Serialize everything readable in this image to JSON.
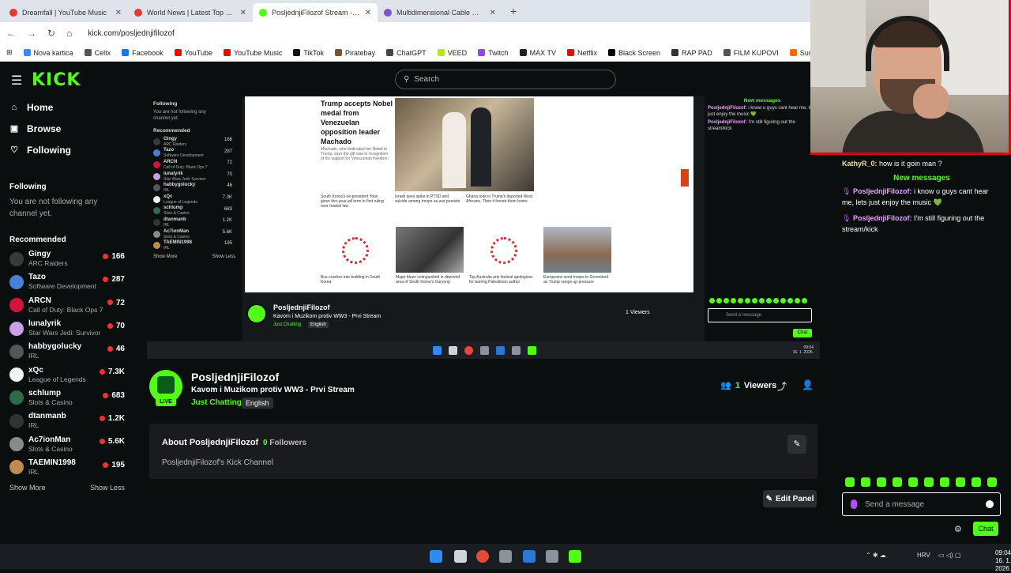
{
  "browser": {
    "tabs": [
      {
        "title": "Dreamfall | YouTube Music",
        "fav_color": "#e53935",
        "active": false
      },
      {
        "title": "World News | Latest Top Stories",
        "fav_color": "#e53935",
        "active": false
      },
      {
        "title": "PosljednjiFilozof Stream - Watch",
        "fav_color": "#53fc18",
        "active": true
      },
      {
        "title": "Multidimensional Cable Myth",
        "fav_color": "#7e57c2",
        "active": false
      }
    ],
    "url": "kick.com/posljednjifilozof",
    "bookmarks": [
      {
        "label": "Nova kartica",
        "color": "#4285f4"
      },
      {
        "label": "Celtx",
        "color": "#555555"
      },
      {
        "label": "Facebook",
        "color": "#1877f2"
      },
      {
        "label": "YouTube",
        "color": "#ff0000"
      },
      {
        "label": "YouTube Music",
        "color": "#ff0000"
      },
      {
        "label": "TikTok",
        "color": "#111111"
      },
      {
        "label": "Piratebay",
        "color": "#7a5230"
      },
      {
        "label": "ChatGPT",
        "color": "#444444"
      },
      {
        "label": "VEED",
        "color": "#b7e61c"
      },
      {
        "label": "Twitch",
        "color": "#9146ff"
      },
      {
        "label": "MAX TV",
        "color": "#222222"
      },
      {
        "label": "Netflix",
        "color": "#e50914"
      },
      {
        "label": "Black Screen",
        "color": "#000000"
      },
      {
        "label": "RAP PAD",
        "color": "#333333"
      },
      {
        "label": "FILM KUPOVI",
        "color": "#555555"
      },
      {
        "label": "Suno",
        "color": "#ff6a00"
      }
    ]
  },
  "header": {
    "logo": "KICK",
    "search_placeholder": "Search"
  },
  "sidebar": {
    "nav": [
      {
        "label": "Home",
        "icon": "home-icon",
        "glyph": "⌂"
      },
      {
        "label": "Browse",
        "icon": "browse-icon",
        "glyph": "▣"
      },
      {
        "label": "Following",
        "icon": "heart-icon",
        "glyph": "♡"
      }
    ],
    "following_title": "Following",
    "following_note": "You are not following any channel yet.",
    "recommended_title": "Recommended",
    "recommended": [
      {
        "name": "Gingy",
        "category": "ARC Raiders",
        "viewers": "166",
        "color": "#3a3a3a"
      },
      {
        "name": "Tazo",
        "category": "Software Development",
        "viewers": "287",
        "color": "#4a7fd6"
      },
      {
        "name": "ARCN",
        "category": "Call of Duty: Black Ops 7",
        "viewers": "72",
        "color": "#d0153a"
      },
      {
        "name": "lunalyrik",
        "category": "Star Wars Jedi: Survivor",
        "viewers": "70",
        "color": "#c9a0e8"
      },
      {
        "name": "habbygolucky",
        "category": "IRL",
        "viewers": "46",
        "color": "#555555"
      },
      {
        "name": "xQc",
        "category": "League of Legends",
        "viewers": "7.3K",
        "color": "#f2f2f2"
      },
      {
        "name": "schlump",
        "category": "Slots & Casino",
        "viewers": "683",
        "color": "#2f6b4a"
      },
      {
        "name": "dtanmanb",
        "category": "IRL",
        "viewers": "1.2K",
        "color": "#333333"
      },
      {
        "name": "Ac7ionMan",
        "category": "Slots & Casino",
        "viewers": "5.6K",
        "color": "#8a8a8a"
      },
      {
        "name": "TAEMIN1998",
        "category": "IRL",
        "viewers": "195",
        "color": "#c08a50"
      }
    ],
    "show_more": "Show More",
    "show_less": "Show Less"
  },
  "embedded": {
    "headline": "Trump accepts Nobel medal from Venezuelan opposition leader Machado",
    "summary": "Machado, who dedicated her Nobel to Trump, says the gift was in recognition of his support for Venezuelan freedom.",
    "small_news": [
      "South Korea's ex-president Yoon given five-year jail term in first ruling over martial law",
      "Israeli sees spike in PTSD and suicide among troops as war persists",
      "Ghana took in Trump's deported West Africans. Then it forced them home"
    ],
    "thumb_captions": [
      "Bus crashes into building in South Korea",
      "Major blaze extinguished in deprived area of South Korea's Guryong",
      "Top Australia arts festival apologises for barring Palestinian author",
      "Europeans send troops to Greenland as Trump ramps up pressure"
    ],
    "chat_new_messages": "New messages",
    "chat_messages": [
      {
        "user": "PosljednjiFilozof:",
        "text": "i know u guys cant hear me, lets just enjoy the music 💚"
      },
      {
        "user": "PosljednjiFilozof:",
        "text": "I'm still figuring out the stream/kick"
      }
    ],
    "chat_placeholder": "Send a message",
    "chat_button": "Chat",
    "viewers": "1 Viewers",
    "clock_time": "09:04",
    "clock_date": "16. 1. 2026."
  },
  "channel": {
    "name": "PosljednjiFilozof",
    "title": "Kavom i Muzikom protiv WW3 - Prvi Stream",
    "category": "Just Chatting",
    "language": "English",
    "live": "LIVE",
    "viewers_count": "1",
    "viewers_label": "Viewers"
  },
  "about": {
    "heading": "About PosljednjiFilozof",
    "followers_count": "0",
    "followers_label": "Followers",
    "description": "PosljednjiFilozof's Kick Channel",
    "edit_panel": "Edit Panel"
  },
  "chat": {
    "messages": [
      {
        "user": "KathyR_0:",
        "text": "how is it goin man ?",
        "user_color": "#f5e08a"
      },
      {
        "user": "PosljednjiFilozof:",
        "text": "i know u guys cant hear me, lets just enjoy the music 💚",
        "user_color": "#e8a5ff"
      },
      {
        "user": "PosljednjiFilozof:",
        "text": "I'm still figuring out the stream/kick",
        "user_color": "#e8a5ff"
      }
    ],
    "new_messages": "New messages",
    "placeholder": "Send a message",
    "send_button": "Chat"
  },
  "taskbar": {
    "language": "HRV",
    "time": "09:04",
    "date": "16. 1. 2026."
  }
}
